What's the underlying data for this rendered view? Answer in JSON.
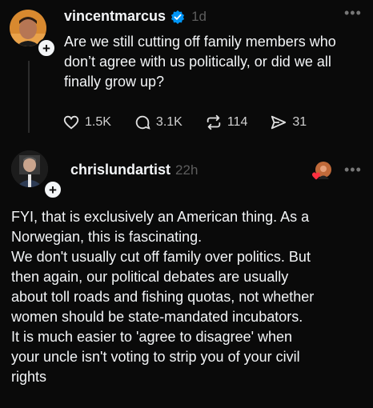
{
  "post": {
    "username": "vincentmarcus",
    "time": "1d",
    "text": "Are we still cutting off family members who don’t agree with us politically, or did we all finally grow up?",
    "stats": {
      "likes": "1.5K",
      "replies": "3.1K",
      "reposts": "114",
      "shares": "31"
    }
  },
  "reply": {
    "username": "chrislundartist",
    "time": "22h",
    "lines": [
      "FYI, that is exclusively an American thing. As a",
      "Norwegian, this is fascinating.",
      "We don't usually cut off family over politics. But",
      "then again, our political debates are usually",
      "about toll roads and fishing quotas, not whether",
      "women should be state-mandated incubators.",
      "It is much easier to 'agree to disagree' when",
      "your uncle isn't voting to strip you of your civil",
      "rights"
    ]
  },
  "colors": {
    "verified": "#0095f6",
    "like_heart": "#ff3040",
    "background": "#0a0a0a",
    "muted": "#5d5d5d"
  }
}
